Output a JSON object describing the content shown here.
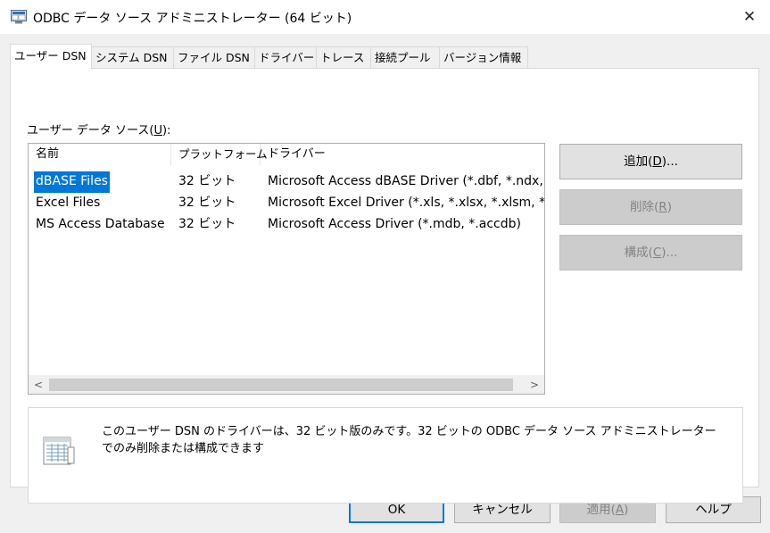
{
  "window": {
    "title": "ODBC データ ソース アドミニストレーター (64 ビット)",
    "close_glyph": "✕"
  },
  "tabs": [
    {
      "label": "ユーザー DSN",
      "active": true
    },
    {
      "label": "システム DSN",
      "active": false
    },
    {
      "label": "ファイル DSN",
      "active": false
    },
    {
      "label": "ドライバー",
      "active": false
    },
    {
      "label": "トレース",
      "active": false
    },
    {
      "label": "接続プール",
      "active": false
    },
    {
      "label": "バージョン情報",
      "active": false
    }
  ],
  "section": {
    "label": "ユーザー データ ソース(",
    "hotkey": "U",
    "suffix": "):"
  },
  "list": {
    "columns": [
      "名前",
      "プラットフォーム",
      "ドライバー"
    ],
    "rows": [
      {
        "name": "dBASE Files",
        "platform": "32 ビット",
        "driver": "Microsoft Access dBASE Driver (*.dbf, *.ndx, *.mdx)",
        "selected": true
      },
      {
        "name": "Excel Files",
        "platform": "32 ビット",
        "driver": "Microsoft Excel Driver (*.xls, *.xlsx, *.xlsm, *.xlsb)",
        "selected": false
      },
      {
        "name": "MS Access Database",
        "platform": "32 ビット",
        "driver": "Microsoft Access Driver (*.mdb, *.accdb)",
        "selected": false
      }
    ],
    "scroll_left": "<",
    "scroll_right": ">"
  },
  "side_buttons": {
    "add": {
      "label": "追加(",
      "hotkey": "D",
      "suffix": ")..."
    },
    "remove": {
      "label": "削除(",
      "hotkey": "R",
      "suffix": ")"
    },
    "configure": {
      "label": "構成(",
      "hotkey": "C",
      "suffix": ")..."
    }
  },
  "info": {
    "text": "このユーザー DSN のドライバーは、32 ビット版のみです。32 ビットの ODBC データ ソース アドミニストレーターでのみ削除または構成できます"
  },
  "bottom_buttons": {
    "ok": "OK",
    "cancel": "キャンセル",
    "apply": {
      "label": "適用(",
      "hotkey": "A",
      "suffix": ")"
    },
    "help": "ヘルプ"
  },
  "colors": {
    "selection": "#0078d7",
    "disabled_text": "#838383",
    "button_face": "#e1e1e1"
  }
}
